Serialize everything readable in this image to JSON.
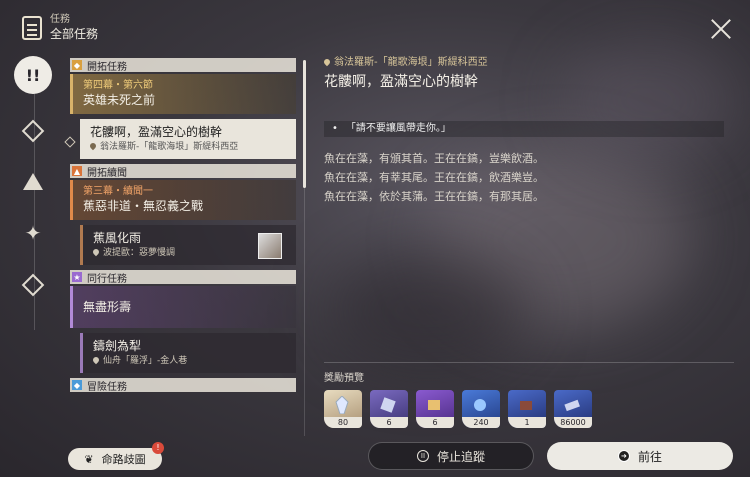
{
  "header": {
    "title_small": "任務",
    "title": "全部任務"
  },
  "rail": [
    {
      "icon": "exclamation-icon",
      "label": "!!"
    },
    {
      "icon": "diamond-icon"
    },
    {
      "icon": "triangle-icon"
    },
    {
      "icon": "star-icon"
    },
    {
      "icon": "diamond-outline-icon"
    }
  ],
  "categories": {
    "trailblaze": "開拓任務",
    "companion_side": "開拓續聞",
    "companion": "同行任務",
    "adventure": "冒險任務"
  },
  "missions": {
    "m1": {
      "sub": "第四幕・第六節",
      "title": "英雄未死之前"
    },
    "m2": {
      "title": "花髏啊，盈滿空心的樹幹",
      "loc": "翁法羅斯-「龍歌海垠」斯緹科西亞"
    },
    "m3": {
      "sub": "第三幕・續聞一",
      "title": "蕉惡非道・無忍義之戰"
    },
    "m4": {
      "title": "蕉風化雨",
      "loc": "波提歐：惡夢慢調"
    },
    "m5": {
      "title": "無盡形壽"
    },
    "m6": {
      "title": "鑄劍為犁",
      "loc": "仙舟「羅浮」-金人巷"
    }
  },
  "detail": {
    "loc": "翁法羅斯-「龍歌海垠」斯緹科西亞",
    "title": "花髏啊，盈滿空心的樹幹",
    "quote": "「請不要讓風帶走你。」",
    "lines": [
      "魚在在藻，有頒其首。王在在鎬，豈樂飲酒。",
      "魚在在藻，有莘其尾。王在在鎬，飲酒樂豈。",
      "魚在在藻，依於其蒲。王在在鎬，有那其居。"
    ]
  },
  "rewards": {
    "label": "獎勵預覽",
    "items": [
      {
        "qty": "80",
        "color": "#d9c9a8",
        "icon": "crystal-icon"
      },
      {
        "qty": "6",
        "color": "#5a4a9a",
        "icon": "ticket-icon"
      },
      {
        "qty": "6",
        "color": "#6a4aa8",
        "icon": "book-icon"
      },
      {
        "qty": "240",
        "color": "#3a5aa8",
        "icon": "dust-icon"
      },
      {
        "qty": "1",
        "color": "#3a5aa8",
        "icon": "chest-icon"
      },
      {
        "qty": "86000",
        "color": "#3a5aa8",
        "icon": "credit-icon"
      }
    ]
  },
  "buttons": {
    "map": "命路歧圖",
    "map_badge": "!",
    "stop": "停止追蹤",
    "go": "前往"
  }
}
